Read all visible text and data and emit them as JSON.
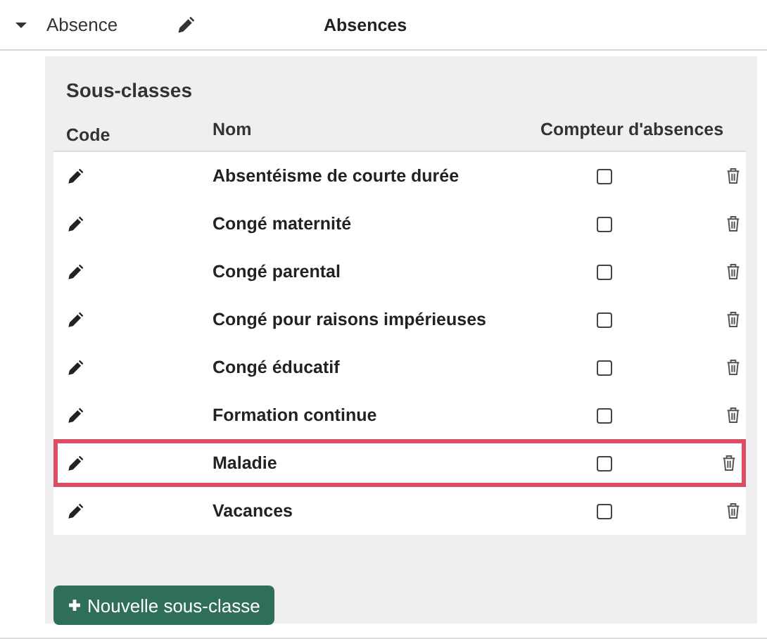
{
  "header": {
    "expanded": true,
    "label": "Absence",
    "title": "Absences"
  },
  "panel": {
    "title": "Sous-classes",
    "columns": [
      "Code",
      "Nom",
      "Compteur d'absences"
    ],
    "rows": [
      {
        "name": "Absentéisme de courte durée",
        "checked": false,
        "selected": false
      },
      {
        "name": "Congé maternité",
        "checked": false,
        "selected": false
      },
      {
        "name": "Congé parental",
        "checked": false,
        "selected": false
      },
      {
        "name": "Congé pour raisons impérieuses",
        "checked": false,
        "selected": false
      },
      {
        "name": "Congé éducatif",
        "checked": false,
        "selected": false
      },
      {
        "name": "Formation continue",
        "checked": false,
        "selected": false
      },
      {
        "name": "Maladie",
        "checked": false,
        "selected": true
      },
      {
        "name": "Vacances",
        "checked": false,
        "selected": false
      }
    ],
    "button": "Nouvelle sous-classe"
  }
}
